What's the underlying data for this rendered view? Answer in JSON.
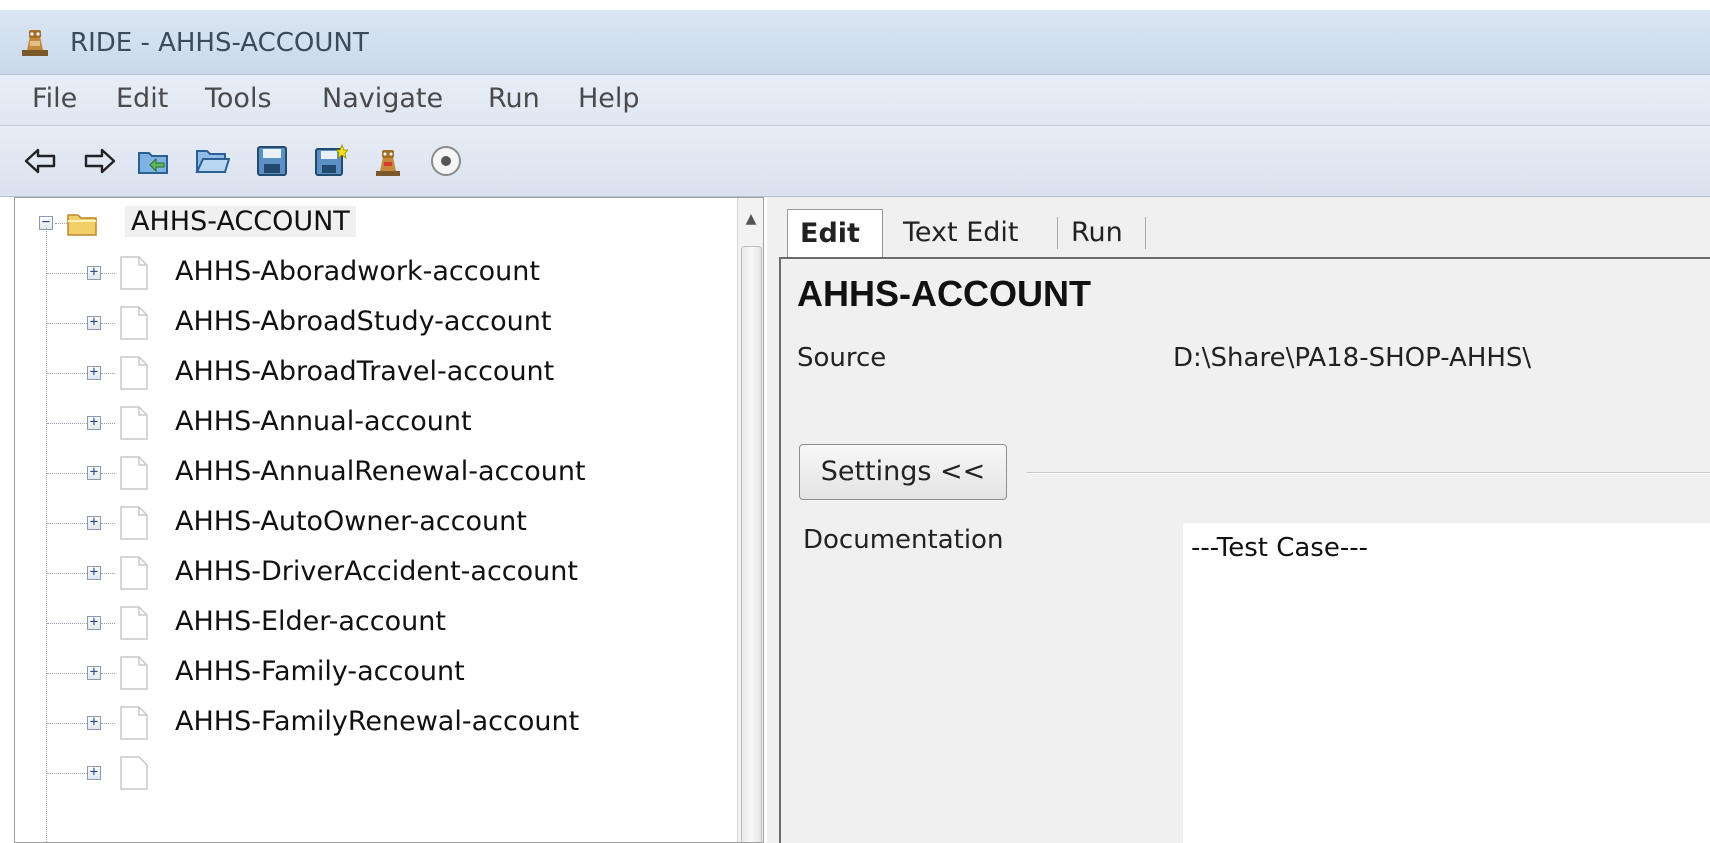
{
  "window": {
    "title": "RIDE - AHHS-ACCOUNT"
  },
  "menu": [
    "File",
    "Edit",
    "Tools",
    "Navigate",
    "Run",
    "Help"
  ],
  "toolbar": {
    "icons": [
      "back-arrow-icon",
      "forward-arrow-icon",
      "open-project-icon",
      "open-folder-icon",
      "save-icon",
      "save-all-icon",
      "robot-icon",
      "stop-circle-icon"
    ]
  },
  "tree": {
    "root": "AHHS-ACCOUNT",
    "items": [
      "AHHS-Aboradwork-account",
      "AHHS-AbroadStudy-account",
      "AHHS-AbroadTravel-account",
      "AHHS-Annual-account",
      "AHHS-AnnualRenewal-account",
      "AHHS-AutoOwner-account",
      "AHHS-DriverAccident-account",
      "AHHS-Elder-account",
      "AHHS-Family-account",
      "AHHS-FamilyRenewal-account"
    ]
  },
  "tabs": [
    "Edit",
    "Text Edit",
    "Run"
  ],
  "editor": {
    "suite_title": "AHHS-ACCOUNT",
    "source_label": "Source",
    "source_value": "D:\\Share\\PA18-SHOP-AHHS\\",
    "settings_button": "Settings <<",
    "documentation_label": "Documentation",
    "documentation_value": "---Test Case---"
  },
  "colors": {
    "titlebar": "#c9d8ea",
    "menubar": "#dfe7f2",
    "panel_bg": "#f0f0f0"
  }
}
